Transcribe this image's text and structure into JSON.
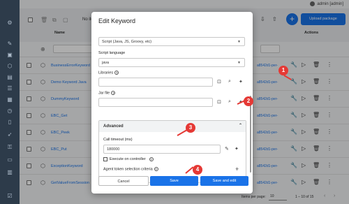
{
  "user": {
    "name": "admin [admin]"
  },
  "toolbar": {
    "no_items_label": "No items s",
    "add_label": "+",
    "upload_label": "Upload package"
  },
  "table": {
    "col_name": "Name",
    "col_actions": "Actions",
    "rows": [
      {
        "name": "BusinessErrorKeyword",
        "revision": "a8542d1-per-"
      },
      {
        "name": "Demo Keyword Java",
        "revision": "a8542d1-per-"
      },
      {
        "name": "DummyKeyword",
        "revision": "a8542d1-per-"
      },
      {
        "name": "EBC_Get",
        "revision": "a8542d1-per-"
      },
      {
        "name": "EBC_Peek",
        "revision": "a8542d1-per-"
      },
      {
        "name": "EBC_Put",
        "revision": "a8542d1-per-"
      },
      {
        "name": "ExceptionKeyword",
        "revision": "a8542d1-per-"
      },
      {
        "name": "GetValueFromSession",
        "revision": "a8542d1-per-"
      }
    ]
  },
  "footer": {
    "items_per_page_label": "Items per page:",
    "items_per_page": "10",
    "range": "1 – 10 of 15"
  },
  "modal": {
    "title": "Edit Keyword",
    "script_type_value": "Script (Java, JS, Groovy, etc)",
    "script_language_label": "Script language",
    "script_language_value": "java",
    "libraries_label": "Libraries",
    "jar_file_label": "Jar file",
    "advanced_label": "Advanced",
    "call_timeout_label": "Call timeout (ms)",
    "call_timeout_value": "180000",
    "execute_on_controller_label": "Execute on controller",
    "agent_token_label": "Agent token selection criteria",
    "cancel_label": "Cancel",
    "save_label": "Save",
    "save_edit_label": "Save and edit"
  },
  "markers": [
    "1",
    "2",
    "3",
    "4"
  ],
  "colors": {
    "sidebar": "#2d3b4a",
    "primary": "#1a73e8",
    "marker": "#e53935"
  }
}
